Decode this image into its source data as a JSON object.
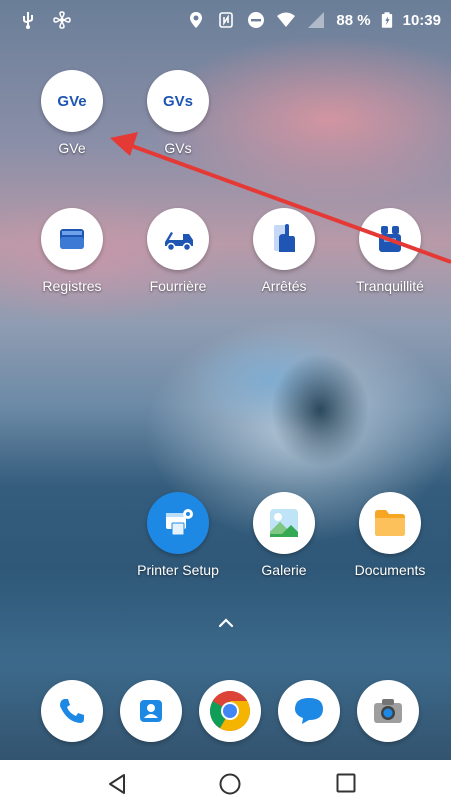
{
  "status_bar": {
    "battery_percent": "88 %",
    "time": "10:39",
    "icons": [
      "usb-icon",
      "fan-icon",
      "location-icon",
      "nfc-icon",
      "dnd-icon",
      "wifi-icon",
      "signal-icon",
      "battery-icon"
    ]
  },
  "apps_row1": [
    {
      "label": "GVe",
      "icon_text": "GVe"
    },
    {
      "label": "GVs",
      "icon_text": "GVs"
    }
  ],
  "apps_row2": [
    {
      "label": "Registres",
      "icon": "registers-icon"
    },
    {
      "label": "Fourrière",
      "icon": "tow-truck-icon"
    },
    {
      "label": "Arrêtés",
      "icon": "document-hand-icon"
    },
    {
      "label": "Tranquillité",
      "icon": "binoculars-icon"
    }
  ],
  "apps_row3": [
    {
      "label": "Printer Setup",
      "icon": "printer-setup-icon"
    },
    {
      "label": "Galerie",
      "icon": "gallery-icon"
    },
    {
      "label": "Documents",
      "icon": "folder-icon"
    }
  ],
  "dock": [
    "phone-icon",
    "contacts-icon",
    "chrome-icon",
    "messages-icon",
    "camera-icon"
  ],
  "navbar": [
    "back-icon",
    "home-icon",
    "recents-icon"
  ],
  "colors": {
    "arrow": "#e53935",
    "gv_text": "#1f56b4",
    "accent_blue": "#1e88e5"
  }
}
